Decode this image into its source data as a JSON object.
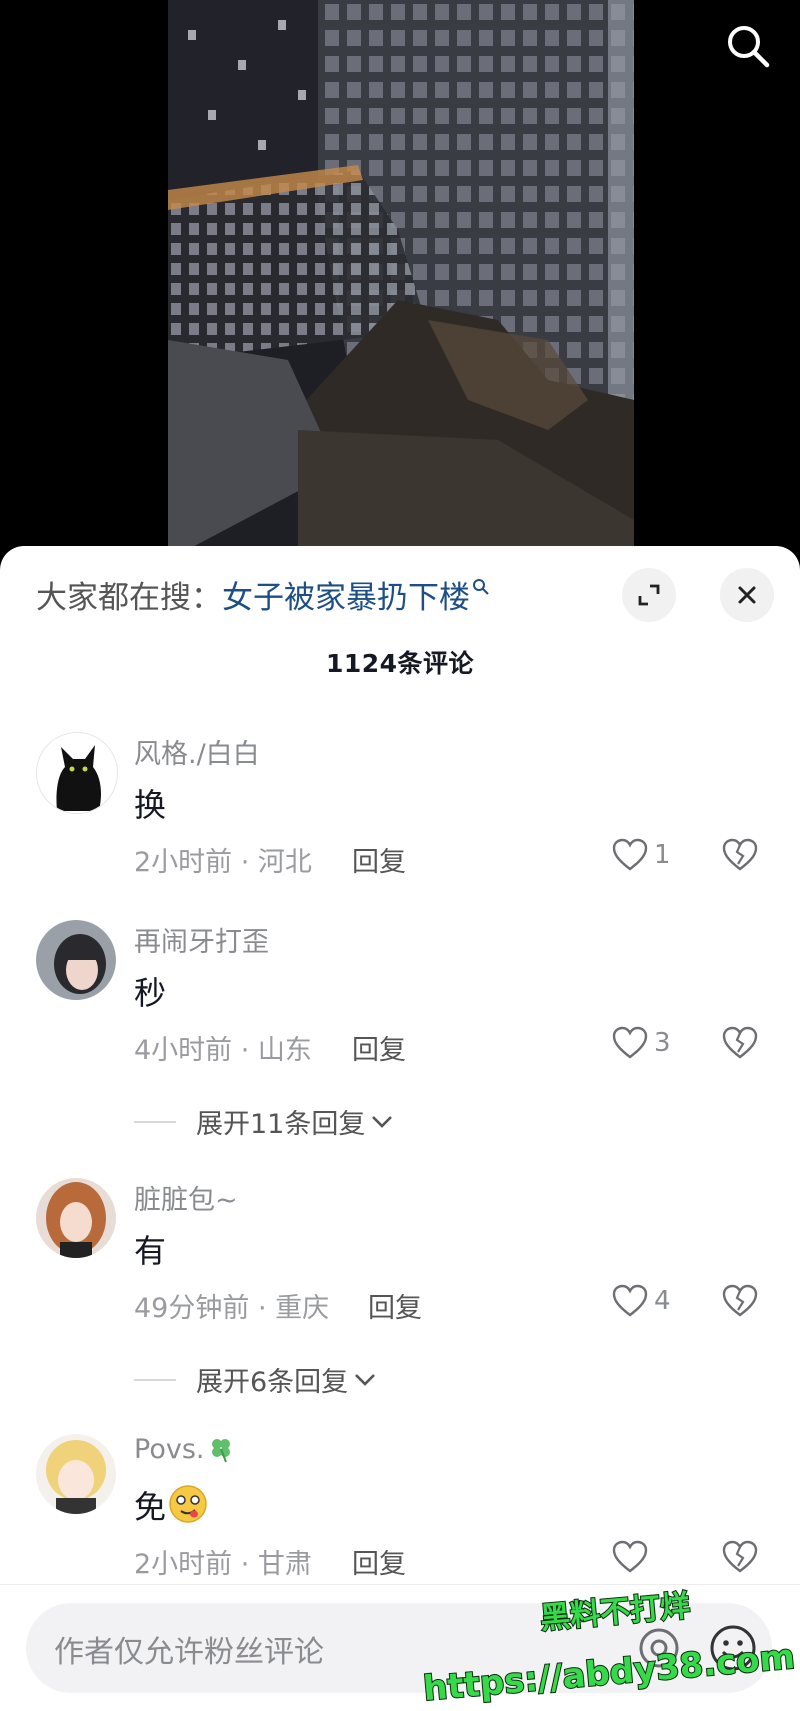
{
  "video": {
    "search_icon": "search-icon"
  },
  "sheet": {
    "trending_label": "大家都在搜：",
    "trending_query": "女子被家暴扔下楼",
    "comment_count": "1124条评论"
  },
  "comments": [
    {
      "username": "风格./白白",
      "text": "换",
      "time_location": "2小时前 · 河北",
      "reply": "回复",
      "likes": "1"
    },
    {
      "username": "再闹牙打歪",
      "text": "秒",
      "time_location": "4小时前 · 山东",
      "reply": "回复",
      "likes": "3",
      "expand": "展开11条回复"
    },
    {
      "username": "脏脏包~",
      "text": "有",
      "time_location": "49分钟前 · 重庆",
      "reply": "回复",
      "likes": "4",
      "expand": "展开6条回复"
    },
    {
      "username": "Povs.",
      "text": "免",
      "time_location": "2小时前 · 甘肃",
      "reply": "回复",
      "likes": ""
    }
  ],
  "input": {
    "placeholder": "作者仅允许粉丝评论"
  },
  "watermark": {
    "line1": "黑料不打烊",
    "line2": "https://abdy38.com"
  },
  "colors": {
    "link": "#1d4f86",
    "watermark_fill": "#35d94a"
  }
}
